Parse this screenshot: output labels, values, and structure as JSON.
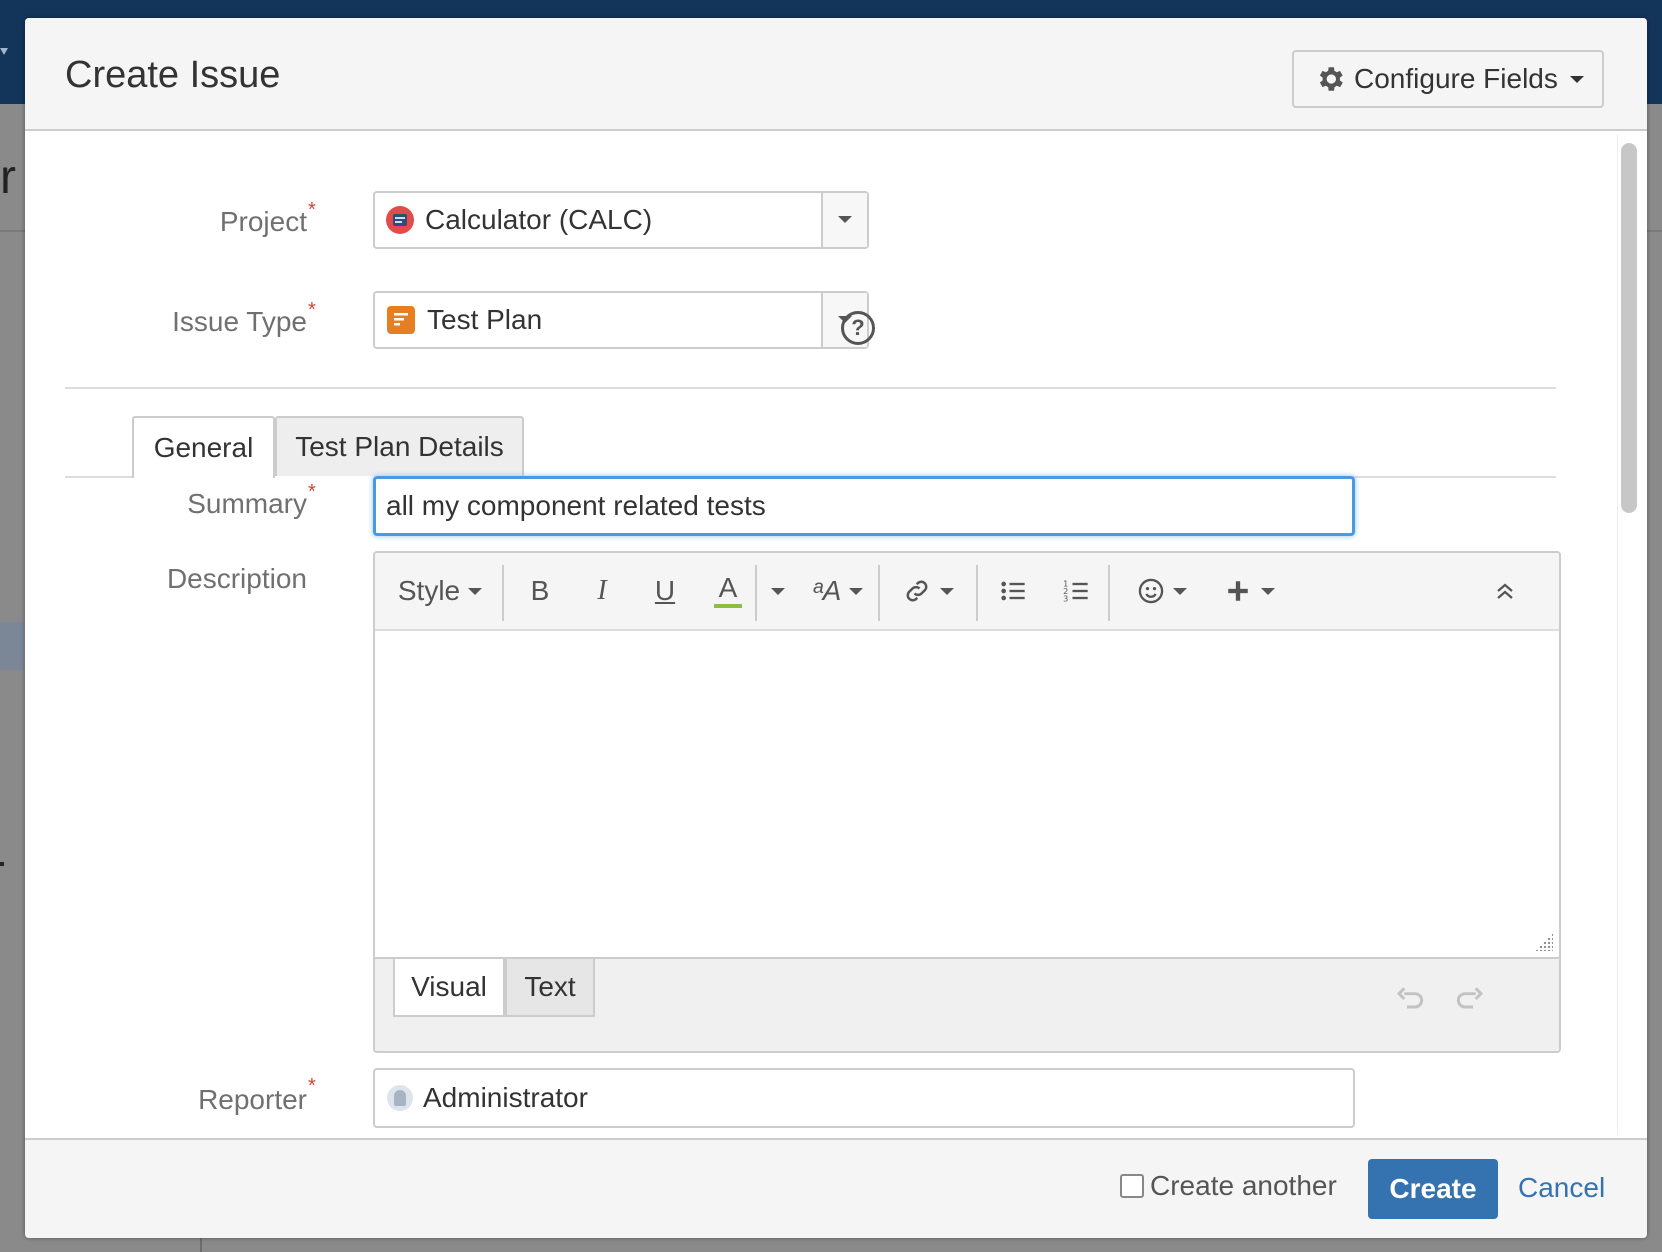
{
  "dialog": {
    "title": "Create Issue",
    "configure_fields": {
      "label": "Configure Fields",
      "icon": "gear-icon"
    }
  },
  "fields": {
    "project": {
      "label": "Project",
      "required_mark": "*",
      "value": "Calculator (CALC)",
      "icon": "project-calculator-icon"
    },
    "issue_type": {
      "label": "Issue Type",
      "required_mark": "*",
      "value": "Test Plan",
      "icon": "test-plan-icon",
      "help_glyph": "?"
    },
    "summary": {
      "label": "Summary",
      "required_mark": "*",
      "value": "all my component related tests"
    },
    "description": {
      "label": "Description"
    },
    "reporter": {
      "label": "Reporter",
      "required_mark": "*",
      "value": "Administrator"
    }
  },
  "tabs": [
    {
      "label": "General",
      "active": true
    },
    {
      "label": "Test Plan Details",
      "active": false
    }
  ],
  "editor": {
    "toolbar": {
      "style_label": "Style",
      "bold": "B",
      "italic": "I",
      "underline": "U",
      "text_color": "A",
      "text_color_underline": "#8bbf3d",
      "font_glyph": "ᵃA",
      "link_icon": "link-icon",
      "bullet_list_icon": "bullet-list-icon",
      "numbered_list_icon": "numbered-list-icon",
      "emoticon_icon": "emoticon-icon",
      "insert_icon": "plus-icon",
      "collapse_icon": "double-chevron-up-icon"
    },
    "modes": [
      {
        "label": "Visual",
        "active": true
      },
      {
        "label": "Text",
        "active": false
      }
    ],
    "undo_icon": "undo-icon",
    "redo_icon": "redo-icon"
  },
  "footer": {
    "create_another_label": "Create another",
    "create_label": "Create",
    "cancel_label": "Cancel"
  },
  "colors": {
    "primary": "#3572b0",
    "required": "#d04437",
    "focus": "#4a9ae1",
    "test_plan_icon": "#e67e22"
  }
}
